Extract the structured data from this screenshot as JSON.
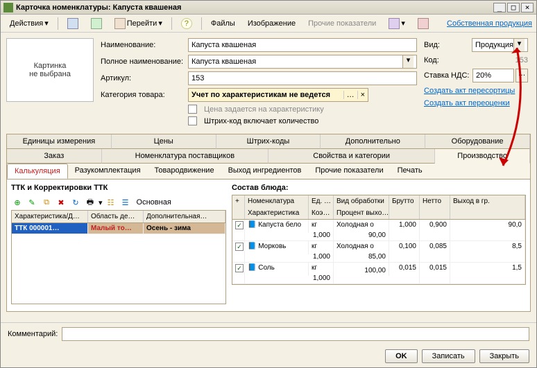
{
  "title": "Карточка номенклатуры: Капуста квашеная",
  "toolbar": {
    "actions": "Действия",
    "goto": "Перейти",
    "files": "Файлы",
    "image": "Изображение",
    "other_indicators": "Прочие показатели",
    "own_production": "Собственная продукция"
  },
  "imgbox": "Картинка\nне выбрана",
  "fields": {
    "name_label": "Наименование:",
    "name_value": "Капуста квашеная",
    "fullname_label": "Полное наименование:",
    "fullname_value": "Капуста квашеная",
    "article_label": "Артикул:",
    "article_value": "153",
    "category_label": "Категория товара:",
    "category_value": "Учет по характеристикам не ведется",
    "price_by_char": "Цена задается на характеристику",
    "barcode_qty": "Штрих-код включает количество"
  },
  "right": {
    "type_label": "Вид:",
    "type_value": "Продукция",
    "code_label": "Код:",
    "code_value": "153",
    "vat_label": "Ставка НДС:",
    "vat_value": "20%",
    "act_resort": "Создать акт пересортицы",
    "act_reval": "Создать акт переоценки"
  },
  "outer_tabs_row1": [
    "Единицы измерения",
    "Цены",
    "Штрих-коды",
    "Дополнительно",
    "Оборудование"
  ],
  "outer_tabs_row2": [
    "Заказ",
    "Номенклатура поставщиков",
    "Свойства и категории",
    "Производство"
  ],
  "sub_tabs": [
    "Калькуляция",
    "Разукомплектация",
    "Товародвижение",
    "Выход ингредиентов",
    "Прочие показатели",
    "Печать"
  ],
  "left_pane_title": "ТТК и Корректировки ТТК",
  "right_pane_title": "Состав блюда:",
  "main_ttk": "Основная",
  "ttk_headers": [
    "Характеристика/Д…",
    "Область де…",
    "Дополнительная…"
  ],
  "ttk_row": [
    "ТТК 000001…",
    "Малый то…",
    "Осень - зима"
  ],
  "dish_headers_r1": [
    "+",
    "Номенклатура",
    "Ед. …",
    "Вид обработки",
    "Брутто",
    "Нетто",
    "Выход в гр."
  ],
  "dish_headers_r2": [
    "",
    "Характеристика",
    "Коэ…",
    "Процент выхо…",
    "",
    "",
    ""
  ],
  "dish_rows": [
    {
      "chk": true,
      "name": "Капуста бело",
      "char": "",
      "unit": "кг",
      "coef": "1,000",
      "proc_type": "Холодная о",
      "proc_pct": "90,00",
      "brutto": "1,000",
      "netto": "0,900",
      "out": "90,0"
    },
    {
      "chk": true,
      "name": "Морковь",
      "char": "",
      "unit": "кг",
      "coef": "1,000",
      "proc_type": "Холодная о",
      "proc_pct": "85,00",
      "brutto": "0,100",
      "netto": "0,085",
      "out": "8,5"
    },
    {
      "chk": true,
      "name": "Соль",
      "char": "",
      "unit": "кг",
      "coef": "1,000",
      "proc_type": "",
      "proc_pct": "100,00",
      "brutto": "0,015",
      "netto": "0,015",
      "out": "1,5"
    }
  ],
  "comment_label": "Комментарий:",
  "buttons": {
    "ok": "OK",
    "save": "Записать",
    "close": "Закрыть"
  }
}
